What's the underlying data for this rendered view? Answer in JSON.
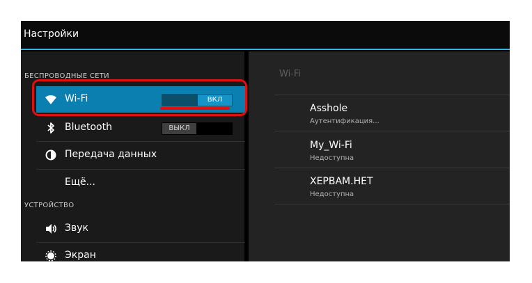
{
  "app": {
    "title": "Настройки"
  },
  "sidebar": {
    "sections": [
      {
        "header": "БЕСПРОВОДНЫЕ СЕТИ"
      },
      {
        "header": "УСТРОЙСТВО"
      }
    ],
    "items": [
      {
        "label": "Wi-Fi",
        "icon": "wifi-icon",
        "toggle": "ВКЛ",
        "selected": true
      },
      {
        "label": "Bluetooth",
        "icon": "bluetooth-icon",
        "toggle": "ВЫКЛ"
      },
      {
        "label": "Передача данных",
        "icon": "data-usage-icon"
      },
      {
        "label": "Ещё..."
      },
      {
        "label": "Звук",
        "icon": "volume-icon"
      },
      {
        "label": "Экран",
        "icon": "brightness-icon"
      }
    ]
  },
  "main": {
    "header": "Wi-Fi",
    "networks": [
      {
        "name": "Asshole",
        "status": "Аутентификация..."
      },
      {
        "name": "My_Wi-Fi",
        "status": "Недоступна"
      },
      {
        "name": "XEPBAM.HET",
        "status": "Недоступна"
      }
    ]
  },
  "colors": {
    "accent": "#33b5e5",
    "selected_row": "#0b7fb0",
    "annotation_red": "#e01010"
  }
}
